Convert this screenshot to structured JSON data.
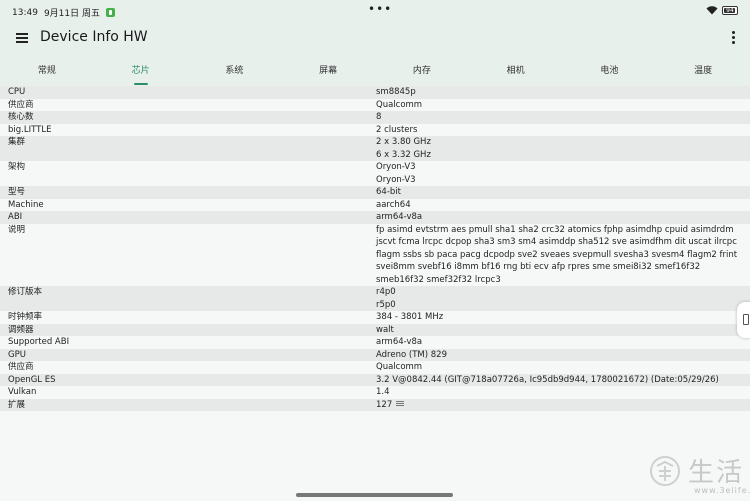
{
  "statusbar": {
    "time": "13:49",
    "date": "9月11日 周五",
    "dots": "•••",
    "battery": "94"
  },
  "appbar": {
    "title": "Device Info HW",
    "menu_icon": "menu-icon",
    "more_icon": "more-vert-icon"
  },
  "tabs": [
    {
      "label": "常规"
    },
    {
      "label": "芯片",
      "active": true
    },
    {
      "label": "系统"
    },
    {
      "label": "屏幕"
    },
    {
      "label": "内存"
    },
    {
      "label": "相机"
    },
    {
      "label": "电池"
    },
    {
      "label": "温度"
    }
  ],
  "rows": [
    {
      "label": "CPU",
      "values": [
        "sm8845p"
      ]
    },
    {
      "label": "供应商",
      "values": [
        "Qualcomm"
      ]
    },
    {
      "label": "核心数",
      "values": [
        "8"
      ]
    },
    {
      "label": "big.LITTLE",
      "values": [
        "2 clusters"
      ]
    },
    {
      "label": "集群",
      "values": [
        "2 x 3.80 GHz",
        "6 x 3.32 GHz"
      ]
    },
    {
      "label": "架构",
      "values": [
        "Oryon-V3",
        "Oryon-V3"
      ]
    },
    {
      "label": "型号",
      "values": [
        "64-bit"
      ]
    },
    {
      "label": "Machine",
      "values": [
        "aarch64"
      ]
    },
    {
      "label": "ABI",
      "values": [
        "arm64-v8a"
      ]
    },
    {
      "label": "说明",
      "values": [
        "fp asimd evtstrm aes pmull sha1 sha2 crc32 atomics fphp asimdhp cpuid asimdrdm jscvt fcma lrcpc dcpop sha3 sm3 sm4 asimddp sha512 sve asimdfhm dit uscat ilrcpc flagm ssbs sb paca pacg dcpodp sve2 sveaes svepmull svesha3 svesm4 flagm2 frint svei8mm svebf16 i8mm bf16 rng bti ecv afp rpres sme smei8i32 smef16f32 smeb16f32 smef32f32 lrcpc3"
      ],
      "wrap": true
    },
    {
      "label": "修订版本",
      "values": [
        "r4p0",
        "r5p0"
      ]
    },
    {
      "label": "时钟频率",
      "values": [
        "384 - 3801 MHz"
      ]
    },
    {
      "label": "调频器",
      "values": [
        "walt"
      ]
    },
    {
      "label": "Supported ABI",
      "values": [
        "arm64-v8a"
      ]
    },
    {
      "label": "GPU",
      "values": [
        "Adreno (TM) 829"
      ]
    },
    {
      "label": "供应商",
      "values": [
        "Qualcomm"
      ]
    },
    {
      "label": "OpenGL ES",
      "values": [
        "3.2 V@0842.44 (GIT@718a07726a, Ic95db9d944, 1780021672) (Date:05/29/26)"
      ]
    },
    {
      "label": "Vulkan",
      "values": [
        "1.4"
      ]
    },
    {
      "label": "扩展",
      "values": [
        "127"
      ],
      "list_icon": true
    }
  ],
  "watermark": {
    "text": "生活",
    "url": "www.3elife.net"
  },
  "colors": {
    "accent": "#2e8c6b",
    "bar_bg": "#e8f0ec",
    "row_alt": "#e7e9e8",
    "page_bg": "#f6f8f7"
  }
}
